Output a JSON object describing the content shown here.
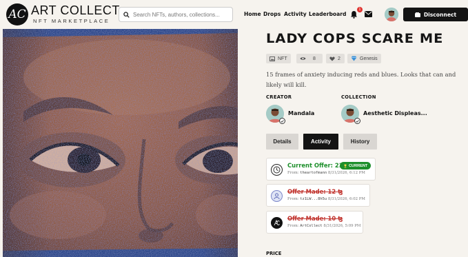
{
  "brand": {
    "title": "ART COLLECT",
    "subtitle": "NFT MARKETPLACE",
    "monogram": "AC"
  },
  "search": {
    "placeholder": "Search NFTs, authors, collections..."
  },
  "nav": [
    {
      "label": "Home"
    },
    {
      "label": "Drops"
    },
    {
      "label": "Activity"
    },
    {
      "label": "Leaderboard"
    }
  ],
  "notifications": {
    "count": "1"
  },
  "account": {
    "disconnect_label": "Disconnect"
  },
  "nft": {
    "title": "LADY COPS SCARE ME",
    "chips": {
      "type": "NFT",
      "views": "8",
      "likes": "2",
      "edition": "Genesis"
    },
    "description": "15 frames of anxiety inducing reds and blues. Looks that can and likely will kill."
  },
  "creator": {
    "label": "CREATOR",
    "name": "Mandala"
  },
  "collection": {
    "label": "COLLECTION",
    "name": "Aesthetic Displeas..."
  },
  "tabs": [
    {
      "label": "Details",
      "active": false
    },
    {
      "label": "Activity",
      "active": true
    },
    {
      "label": "History",
      "active": false
    }
  ],
  "offers": [
    {
      "title": "Current Offer: 23 ꜩ",
      "badge": "CURRENT",
      "from_label": "From:",
      "from": "theartofmann",
      "date": "8/31/2026, 6:12 PM",
      "status": "current"
    },
    {
      "title": "Offer Made: 12 ꜩ",
      "from_label": "From:",
      "from": "tz1LW...8h5u",
      "date": "8/31/2026, 6:02 PM",
      "status": "struck"
    },
    {
      "title": "Offer Made: 10 ꜩ",
      "from_label": "From:",
      "from": "ArtCollect",
      "date": "8/31/2026, 5:09 PM",
      "status": "struck"
    }
  ],
  "price": {
    "label": "PRICE"
  },
  "colors": {
    "accent_green": "#1d8f2b",
    "strike_red": "#c0312b",
    "dark": "#141414",
    "background": "#f6f3ee"
  },
  "icons": [
    "search-icon",
    "bell-icon",
    "mail-icon",
    "wallet-icon",
    "image-icon",
    "eye-icon",
    "heart-icon",
    "diamond-icon",
    "check-icon",
    "clock-icon",
    "user-icon",
    "trophy-icon"
  ]
}
